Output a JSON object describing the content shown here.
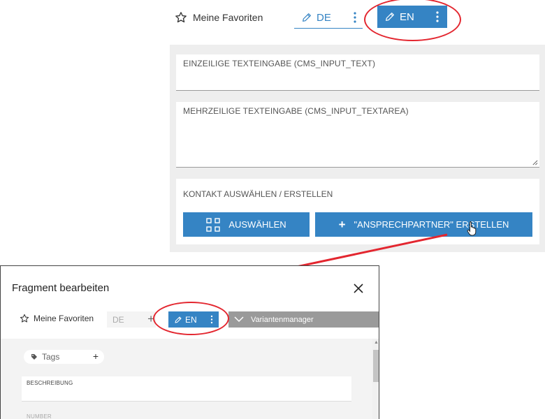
{
  "top_toolbar": {
    "favorites_label": "Meine Favoriten",
    "tab_de_label": "DE",
    "tab_en_label": "EN"
  },
  "form": {
    "field_single_label": "EINZEILIGE TEXTEINGABE (CMS_INPUT_TEXT)",
    "field_single_value": "",
    "field_multi_label": "MEHRZEILIGE TEXTEINGABE (CMS_INPUT_TEXTAREA)",
    "field_multi_value": "",
    "contact_label": "KONTAKT AUSWÄHLEN / ERSTELLEN",
    "select_button_label": "AUSWÄHLEN",
    "create_button_label": "\"ANSPRECHPARTNER\" ERSTELLEN"
  },
  "dialog": {
    "title": "Fragment bearbeiten",
    "favorites_label": "Meine Favoriten",
    "tab_de_label": "DE",
    "tab_en_label": "EN",
    "variant_manager_label": "Variantenmanager",
    "tags_label": "Tags",
    "description_label": "BESCHREIBUNG",
    "number_label": "NUMBER"
  },
  "colors": {
    "accent": "#3584c4",
    "annotation_red": "#e3262f",
    "panel_bg": "#eeeeee",
    "variant_bg": "#9a9a9a"
  },
  "icons": [
    "star-icon",
    "pencil-icon",
    "kebab-menu-icon",
    "grid-icon",
    "plus-icon",
    "hand-cursor-icon",
    "close-icon",
    "tag-icon",
    "chevron-down-icon"
  ]
}
